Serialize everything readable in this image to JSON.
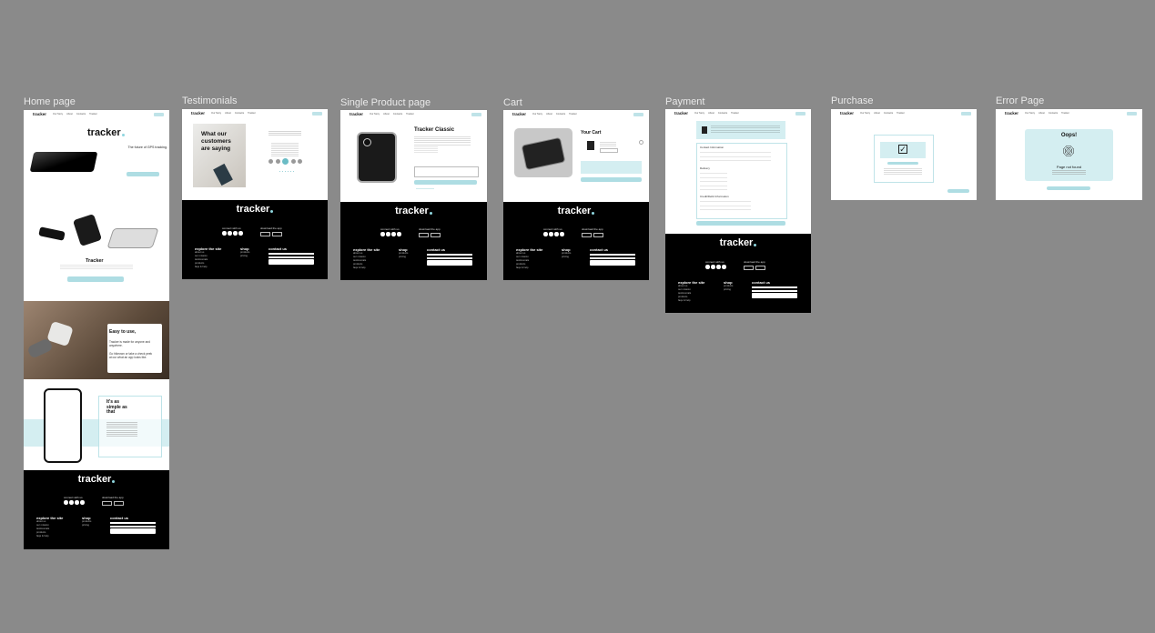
{
  "frames": {
    "home": {
      "label": "Home page"
    },
    "testimonials": {
      "label": "Testimonials"
    },
    "product": {
      "label": "Single Product page"
    },
    "cart": {
      "label": "Cart"
    },
    "payment": {
      "label": "Payment"
    },
    "purchase": {
      "label": "Purchase"
    },
    "error": {
      "label": "Error Page"
    }
  },
  "nav": {
    "logo": "tracker",
    "links": [
      "Our Story",
      "About",
      "Contacts",
      "Tracker"
    ]
  },
  "brand": {
    "logo": "tracker"
  },
  "home": {
    "hero_text": "The future of GPS tracking.",
    "product_title": "Tracker",
    "easy_title": "Easy to use,",
    "easy_line1": "Tracker is made for anyone and anywhere.",
    "easy_line2": "Go hikeown or take a check peek at our what an app looks like.",
    "simple_title": "It's as simple as that"
  },
  "testimonials": {
    "title": "What our customers are saying"
  },
  "product": {
    "title": "Tracker Classic"
  },
  "cart": {
    "title": "Your Cart"
  },
  "payment": {
    "section1": "Contact Information",
    "section2": "Delivery",
    "section3": "Credit/Debit Information"
  },
  "error": {
    "title": "Oops!",
    "subtitle": "Page not found"
  },
  "footer": {
    "connect": "connect with us",
    "download": "download the app",
    "explore": "explore the site",
    "shop": "shop",
    "contact": "contact us",
    "explore_links": [
      "about us",
      "our mission",
      "testimonials",
      "products",
      "faqs & help"
    ],
    "shop_links": [
      "products",
      "pricing"
    ]
  },
  "colors": {
    "canvas": "#8a8a8a",
    "accent": "#aedde3",
    "accent_light": "#d4eef1",
    "footer": "#000000"
  }
}
